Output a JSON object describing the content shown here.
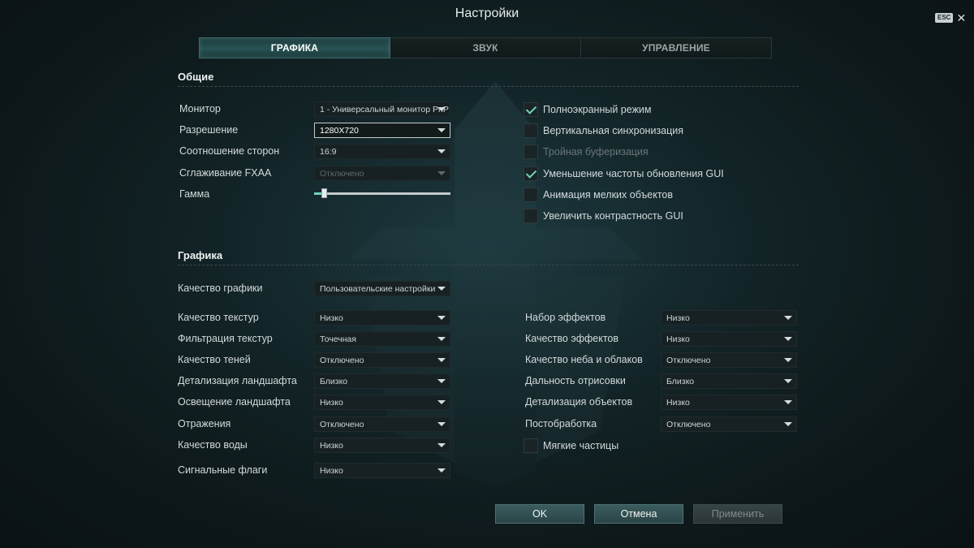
{
  "title": "Настройки",
  "esc_key": "ESC",
  "close_glyph": "✕",
  "tabs": [
    {
      "label": "ГРАФИКА",
      "active": true
    },
    {
      "label": "ЗВУК",
      "active": false
    },
    {
      "label": "УПРАВЛЕНИЕ",
      "active": false
    }
  ],
  "general": {
    "heading": "Общие",
    "monitor": {
      "label": "Монитор",
      "value": "1 - Универсальный монитор PnP"
    },
    "resolution": {
      "label": "Разрешение",
      "value": "1280X720"
    },
    "aspect": {
      "label": "Соотношение сторон",
      "value": "16:9"
    },
    "fxaa": {
      "label": "Сглаживание FXAA",
      "value": "Отключено"
    },
    "gamma": {
      "label": "Гамма",
      "level_percent": 7
    },
    "checkboxes": [
      {
        "label": "Полноэкранный режим",
        "checked": true,
        "enabled": true
      },
      {
        "label": "Вертикальная синхронизация",
        "checked": false,
        "enabled": true
      },
      {
        "label": "Тройная буферизация",
        "checked": false,
        "enabled": false
      },
      {
        "label": "Уменьшение частоты обновления GUI",
        "checked": true,
        "enabled": true
      },
      {
        "label": "Анимация мелких объектов",
        "checked": false,
        "enabled": true
      },
      {
        "label": "Увеличить контрастность GUI",
        "checked": false,
        "enabled": true
      }
    ]
  },
  "graphics": {
    "heading": "Графика",
    "quality": {
      "label": "Качество графики",
      "value": "Пользовательские настройки"
    },
    "left": [
      {
        "label": "Качество текстур",
        "value": "Низко"
      },
      {
        "label": "Фильтрация текстур",
        "value": "Точечная"
      },
      {
        "label": "Качество теней",
        "value": "Отключено"
      },
      {
        "label": "Детализация ландшафта",
        "value": "Близко"
      },
      {
        "label": "Освещение ландшафта",
        "value": "Низко"
      },
      {
        "label": "Отражения",
        "value": "Отключено"
      },
      {
        "label": "Качество воды",
        "value": "Низко"
      }
    ],
    "flags": {
      "label": "Сигнальные флаги",
      "value": "Низко"
    },
    "right": [
      {
        "label": "Набор эффектов",
        "value": "Низко"
      },
      {
        "label": "Качество эффектов",
        "value": "Низко"
      },
      {
        "label": "Качество неба и облаков",
        "value": "Отключено"
      },
      {
        "label": "Дальность отрисовки",
        "value": "Близко"
      },
      {
        "label": "Детализация объектов",
        "value": "Низко"
      },
      {
        "label": "Постобработка",
        "value": "Отключено"
      }
    ],
    "soft_particles": {
      "label": "Мягкие частицы",
      "checked": false
    }
  },
  "buttons": {
    "ok": "OK",
    "cancel": "Отмена",
    "apply": "Применить"
  },
  "colors": {
    "accent": "#6fd3b9",
    "tab_active": "#275254",
    "button": "#3b5c5e"
  }
}
